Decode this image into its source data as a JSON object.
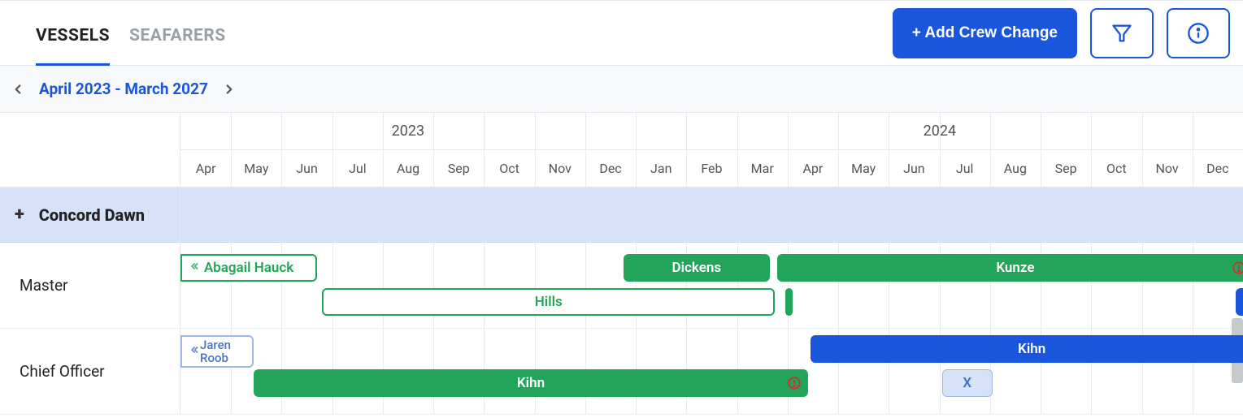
{
  "tabs": {
    "vessels": "VESSELS",
    "seafarers": "SEAFARERS"
  },
  "header": {
    "add_crew_change": "+ Add Crew Change"
  },
  "date_range": "April 2023 - March 2027",
  "years": [
    "2023",
    "2024"
  ],
  "months": [
    "Apr",
    "May",
    "Jun",
    "Jul",
    "Aug",
    "Sep",
    "Oct",
    "Nov",
    "Dec",
    "Jan",
    "Feb",
    "Mar",
    "Apr",
    "May",
    "Jun",
    "Jul",
    "Aug",
    "Sep",
    "Oct",
    "Nov",
    "Dec"
  ],
  "vessel": {
    "name": "Concord Dawn"
  },
  "ranks": {
    "master": "Master",
    "chief_officer": "Chief Officer"
  },
  "bars": {
    "abagail_hauck": "Abagail Hauck",
    "dickens": "Dickens",
    "kunze": "Kunze",
    "hills": "Hills",
    "jaren_roob": "Jaren\nRoob",
    "kihn_green": "Kihn",
    "kihn_blue": "Kihn",
    "x": "X"
  },
  "chart_data": {
    "type": "gantt",
    "time_axis": {
      "start": "2023-04",
      "end": "2024-12",
      "months": [
        "2023-04",
        "2023-05",
        "2023-06",
        "2023-07",
        "2023-08",
        "2023-09",
        "2023-10",
        "2023-11",
        "2023-12",
        "2024-01",
        "2024-02",
        "2024-03",
        "2024-04",
        "2024-05",
        "2024-06",
        "2024-07",
        "2024-08",
        "2024-09",
        "2024-10",
        "2024-11",
        "2024-12"
      ]
    },
    "vessel": "Concord Dawn",
    "rows": [
      {
        "rank": "Master",
        "assignments": [
          {
            "name": "Abagail Hauck",
            "style": "outline-green",
            "start": "2023-04",
            "end": "2023-06",
            "continues_left": true
          },
          {
            "name": "Dickens",
            "style": "green",
            "start": "2024-01",
            "end": "2024-03"
          },
          {
            "name": "Kunze",
            "style": "green",
            "start": "2024-04",
            "end": "2024-12",
            "alert": true,
            "continues_right": true
          },
          {
            "name": "Hills",
            "style": "outline-green",
            "start": "2023-07",
            "end": "2024-03"
          },
          {
            "name": "",
            "style": "green-sliver",
            "start": "2024-04",
            "end": "2024-04"
          }
        ]
      },
      {
        "rank": "Chief Officer",
        "assignments": [
          {
            "name": "Jaren Roob",
            "style": "outline-blue",
            "start": "2023-04",
            "end": "2023-05",
            "continues_left": true
          },
          {
            "name": "Kihn",
            "style": "blue",
            "start": "2024-04",
            "end": "2024-12",
            "continues_right": true
          },
          {
            "name": "Kihn",
            "style": "green",
            "start": "2023-05",
            "end": "2024-04",
            "alert": true
          },
          {
            "name": "X",
            "style": "lightblue",
            "start": "2024-07",
            "end": "2024-08"
          }
        ]
      }
    ]
  }
}
